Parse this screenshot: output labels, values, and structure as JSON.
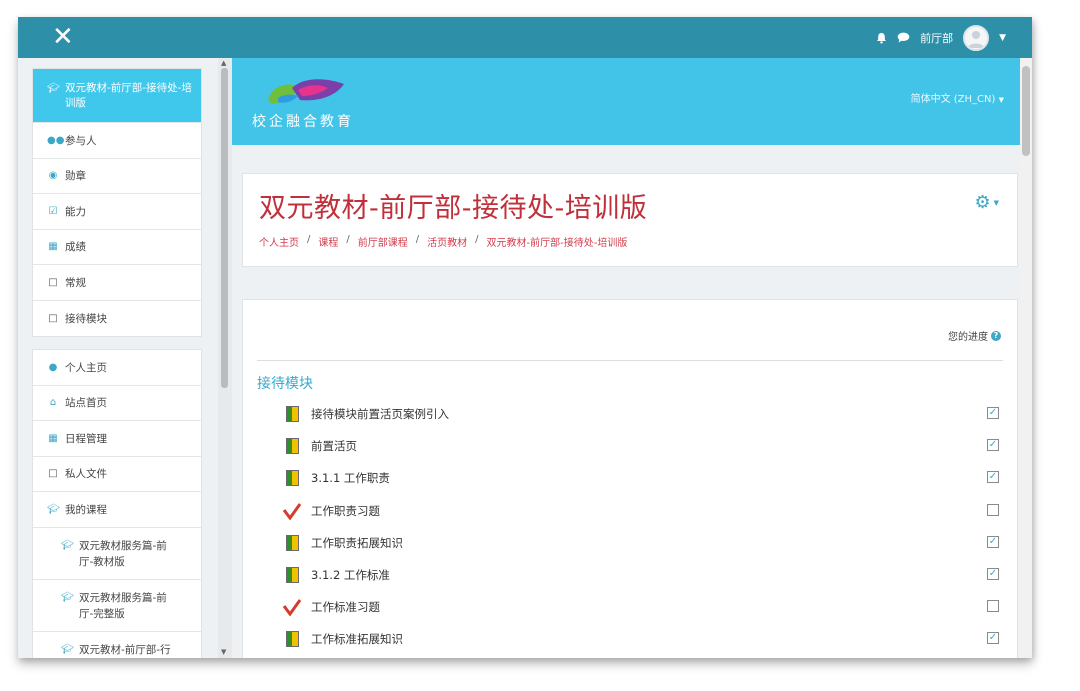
{
  "navbar": {
    "close_glyph": "✕",
    "user_name": "前厅部"
  },
  "drawer": {
    "course_items": [
      {
        "label": "双元教材-前厅部-接待处-培训版",
        "icon": "graduation-cap-icon"
      },
      {
        "label": "参与人",
        "icon": "users-icon"
      },
      {
        "label": "勋章",
        "icon": "badge-icon"
      },
      {
        "label": "能力",
        "icon": "competency-check-icon"
      },
      {
        "label": "成绩",
        "icon": "grades-table-icon"
      },
      {
        "label": "常规",
        "icon": "folder-icon"
      },
      {
        "label": "接待模块",
        "icon": "folder-icon"
      }
    ],
    "site_items": [
      {
        "label": "个人主页",
        "icon": "dashboard-icon"
      },
      {
        "label": "站点首页",
        "icon": "home-icon"
      },
      {
        "label": "日程管理",
        "icon": "calendar-icon"
      },
      {
        "label": "私人文件",
        "icon": "file-icon"
      },
      {
        "label": "我的课程",
        "icon": "graduation-cap-icon"
      },
      {
        "label": "双元教材服务篇-前厅-教材版",
        "icon": "graduation-cap-icon"
      },
      {
        "label": "双元教材服务篇-前厅-完整版",
        "icon": "graduation-cap-icon"
      },
      {
        "label": "双元教材-前厅部-行",
        "icon": "graduation-cap-icon"
      }
    ]
  },
  "banner": {
    "logo_text": "校企融合教育",
    "language": "简体中文 (ZH_CN)"
  },
  "header": {
    "title": "双元教材-前厅部-接待处-培训版",
    "breadcrumb": [
      "个人主页",
      "课程",
      "前厅部课程",
      "活页教材",
      "双元教材-前厅部-接待处-培训版"
    ]
  },
  "content": {
    "progress_label": "您的进度",
    "section_title": "接待模块",
    "activities": [
      {
        "name": "接待模块前置活页案例引入",
        "type": "book",
        "completed": true
      },
      {
        "name": "前置活页",
        "type": "book",
        "completed": true
      },
      {
        "name": "3.1.1 工作职责",
        "type": "book",
        "completed": true
      },
      {
        "name": "工作职责习题",
        "type": "quiz",
        "completed": false
      },
      {
        "name": "工作职责拓展知识",
        "type": "book",
        "completed": true
      },
      {
        "name": "3.1.2 工作标准",
        "type": "book",
        "completed": true
      },
      {
        "name": "工作标准习题",
        "type": "quiz",
        "completed": false
      },
      {
        "name": "工作标准拓展知识",
        "type": "book",
        "completed": true
      }
    ]
  },
  "colors": {
    "navbar": "#2e8fa8",
    "banner": "#42c4e8",
    "active_item": "#40c8ec",
    "title_red": "#c0303a",
    "section_blue": "#38a9d0"
  }
}
